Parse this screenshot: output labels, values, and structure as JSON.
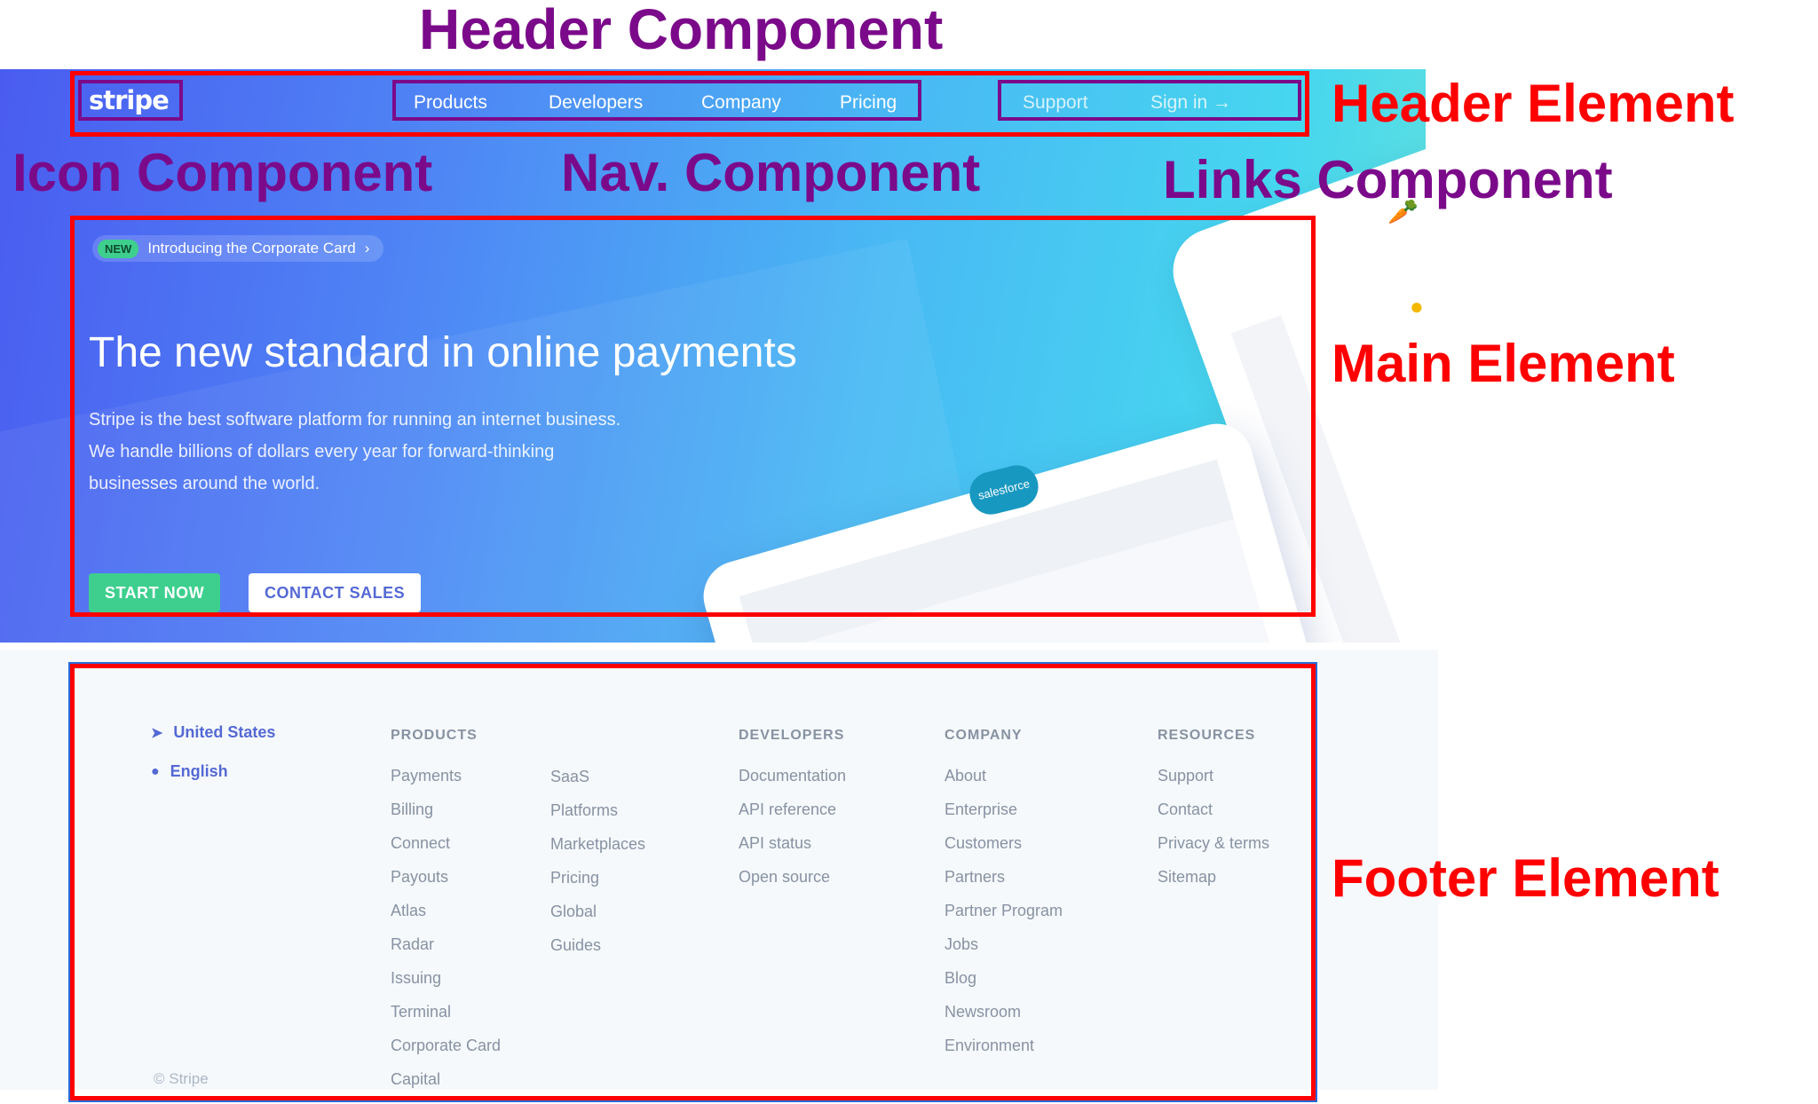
{
  "header": {
    "logo": "stripe",
    "nav": [
      "Products",
      "Developers",
      "Company",
      "Pricing"
    ],
    "links": [
      "Support",
      "Sign in →"
    ]
  },
  "main": {
    "badge": "NEW",
    "announcement": "Introducing the Corporate Card",
    "title": "The new standard in online payments",
    "subtitle": "Stripe is the best software platform for running an internet business. We handle billions of dollars every year for forward-thinking businesses around the world.",
    "cta_primary": "START NOW",
    "cta_secondary": "CONTACT SALES",
    "device_logo": "salesforce"
  },
  "footer": {
    "locale": {
      "country": "United States",
      "language": "English"
    },
    "columns": [
      {
        "heading": "PRODUCTS",
        "links": [
          "Payments",
          "Billing",
          "Connect",
          "Payouts",
          "Atlas",
          "Radar",
          "Issuing",
          "Terminal",
          "Corporate Card",
          "Capital"
        ]
      },
      {
        "heading": "",
        "links": [
          "SaaS",
          "Platforms",
          "Marketplaces",
          "Pricing",
          "Global",
          "Guides"
        ]
      },
      {
        "heading": "DEVELOPERS",
        "links": [
          "Documentation",
          "API reference",
          "API status",
          "Open source"
        ]
      },
      {
        "heading": "COMPANY",
        "links": [
          "About",
          "Enterprise",
          "Customers",
          "Partners",
          "Partner Program",
          "Jobs",
          "Blog",
          "Newsroom",
          "Environment"
        ]
      },
      {
        "heading": "RESOURCES",
        "links": [
          "Support",
          "Contact",
          "Privacy & terms",
          "Sitemap"
        ]
      }
    ],
    "copyright": "© Stripe"
  },
  "annotations": {
    "header_component": "Header Component",
    "icon_component": "Icon Component",
    "nav_component": "Nav. Component",
    "links_component": "Links Component",
    "header_element": "Header Element",
    "main_element": "Main Element",
    "footer_element": "Footer Element"
  },
  "colors": {
    "annotation_purple": "#7b0a8a",
    "annotation_red": "#ff0000",
    "stripe_green": "#3ecf8e",
    "stripe_blurple": "#5469d4"
  }
}
